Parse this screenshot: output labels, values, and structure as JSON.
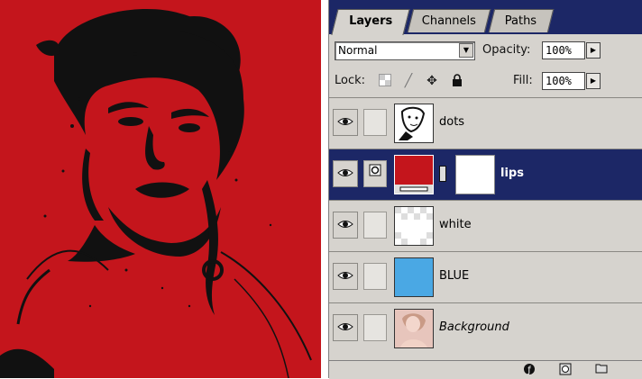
{
  "panel": {
    "tabs": [
      {
        "label": "Layers",
        "active": true
      },
      {
        "label": "Channels",
        "active": false
      },
      {
        "label": "Paths",
        "active": false
      }
    ],
    "blend_mode": "Normal",
    "opacity_label": "Opacity:",
    "opacity_value": "100%",
    "lock_label": "Lock:",
    "fill_label": "Fill:",
    "fill_value": "100%",
    "layers": [
      {
        "name": "dots",
        "thumb": "dots-thumbnail",
        "selected": false,
        "visible": true
      },
      {
        "name": "lips",
        "thumb": "red-fill-thumbnail",
        "mask": true,
        "selected": true,
        "visible": true
      },
      {
        "name": "white",
        "thumb": "transparent-thumbnail",
        "selected": false,
        "visible": true
      },
      {
        "name": "BLUE",
        "thumb": "blue-fill-thumbnail",
        "selected": false,
        "visible": true
      },
      {
        "name": "Background",
        "thumb": "photo-thumbnail",
        "selected": false,
        "visible": true,
        "italic": true
      }
    ]
  },
  "colors": {
    "canvas_red": "#c4151c",
    "selection_blue": "#1c2766",
    "blue_fill": "#4aa8e4",
    "panel_gray": "#d6d3ce"
  },
  "icons": {
    "lock": [
      "transparency-lock-icon",
      "brush-lock-icon",
      "move-lock-icon",
      "padlock-icon"
    ],
    "bottom": [
      "layer-style-icon",
      "add-mask-icon",
      "new-set-icon"
    ]
  }
}
